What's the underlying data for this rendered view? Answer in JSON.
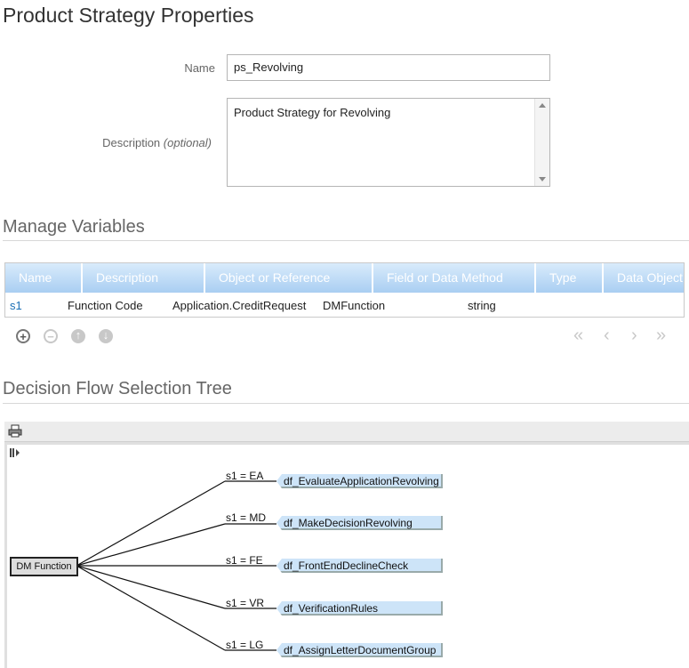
{
  "page": {
    "title": "Product Strategy Properties"
  },
  "form": {
    "name_label": "Name",
    "name_value": "ps_Revolving",
    "description_label": "Description",
    "description_optional": "(optional)",
    "description_value": "Product Strategy for Revolving"
  },
  "variables": {
    "section_title": "Manage Variables",
    "columns": [
      "Name",
      "Description",
      "Object or Reference",
      "Field or Data Method",
      "Type",
      "Data Object"
    ],
    "rows": [
      {
        "name": "s1",
        "description": "Function Code",
        "object": "Application.CreditRequest",
        "field": "DMFunction",
        "type": "string",
        "data_object": ""
      }
    ],
    "actions": {
      "add": "add-icon",
      "remove": "remove-icon",
      "up": "move-up-icon",
      "down": "move-down-icon"
    },
    "pager": {
      "first": "«",
      "prev": "‹",
      "next": "›",
      "last": "»"
    }
  },
  "tree": {
    "section_title": "Decision Flow Selection Tree",
    "root": "DM Function",
    "branches": [
      {
        "condition": "s1 = EA",
        "flow": "df_EvaluateApplicationRevolving"
      },
      {
        "condition": "s1 = MD",
        "flow": "df_MakeDecisionRevolving"
      },
      {
        "condition": "s1 = FE",
        "flow": "df_FrontEndDeclineCheck"
      },
      {
        "condition": "s1 = VR",
        "flow": "df_VerificationRules"
      },
      {
        "condition": "s1 = LG",
        "flow": "df_AssignLetterDocumentGroup"
      }
    ]
  },
  "colors": {
    "accent": "#1a6fb5",
    "header_top": "#d9ebfb",
    "header_bottom": "#a9cef2",
    "leaf": "#cde4f8"
  }
}
